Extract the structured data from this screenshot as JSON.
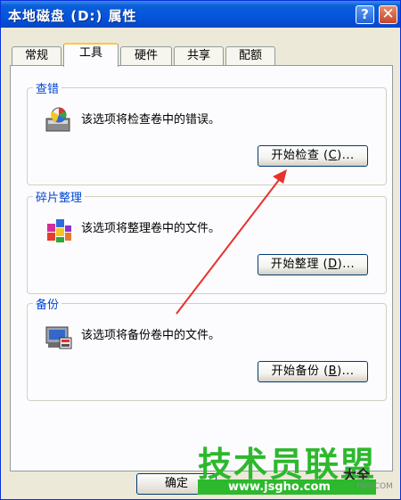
{
  "window": {
    "title": "本地磁盘 (D:) 属性",
    "help_glyph": "?",
    "close_glyph": "✕"
  },
  "tabs": [
    {
      "label": "常规",
      "active": false
    },
    {
      "label": "工具",
      "active": true
    },
    {
      "label": "硬件",
      "active": false
    },
    {
      "label": "共享",
      "active": false
    },
    {
      "label": "配额",
      "active": false
    }
  ],
  "groups": {
    "error_check": {
      "title": "查错",
      "description": "该选项将检查卷中的错误。",
      "button_prefix": "开始检查 (",
      "button_key": "C",
      "button_suffix": ")...",
      "icon": "check-disk-icon"
    },
    "defrag": {
      "title": "碎片整理",
      "description": "该选项将整理卷中的文件。",
      "button_prefix": "开始整理 (",
      "button_key": "D",
      "button_suffix": ")...",
      "icon": "defragment-icon"
    },
    "backup": {
      "title": "备份",
      "description": "该选项将备份卷中的文件。",
      "button_prefix": "开始备份 (",
      "button_key": "B",
      "button_suffix": ")...",
      "icon": "backup-icon"
    }
  },
  "footer": {
    "ok_label": "确定"
  },
  "watermark": {
    "main": "技术员联盟",
    "url": "www.jsgho.com",
    "side": "大全",
    "fragment": "P85.COM"
  },
  "annotation_arrow_color": "#e8312a",
  "accent_colors": {
    "titlebar": "#0554dc",
    "group_title": "#0046d5",
    "active_tab_highlight": "#ffc83c",
    "watermark_green": "#2db82d"
  }
}
